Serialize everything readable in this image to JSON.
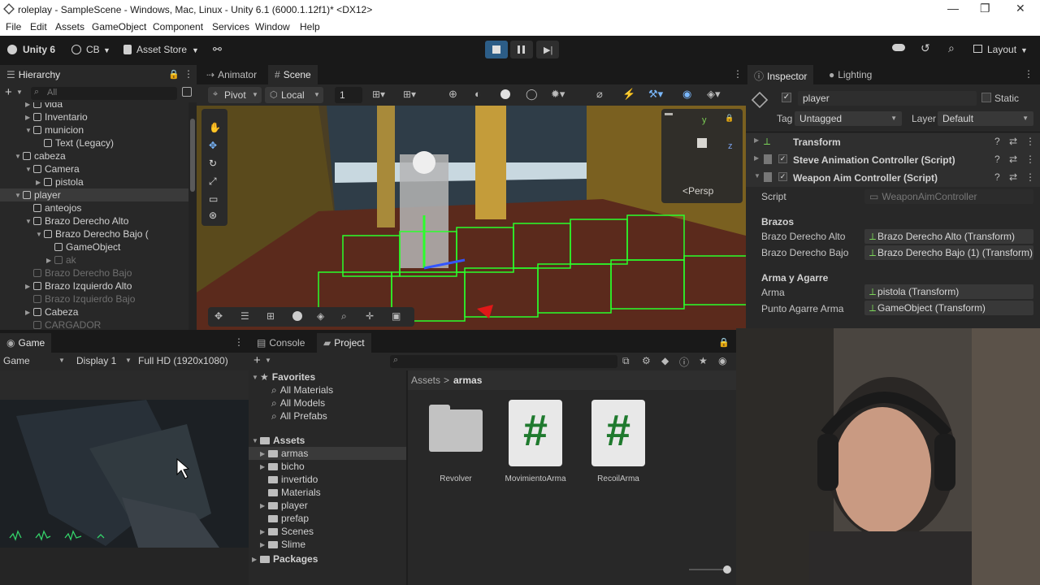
{
  "window": {
    "title": "roleplay - SampleScene - Windows, Mac, Linux - Unity 6.1 (6000.1.12f1)* <DX12>",
    "minimize": "—",
    "maximize": "❐",
    "close": "✕"
  },
  "menu": [
    "File",
    "Edit",
    "Assets",
    "GameObject",
    "Component",
    "Services",
    "Window",
    "Help"
  ],
  "toolbar": {
    "unity_label": "Unity 6",
    "account_label": "CB",
    "asset_store_label": "Asset Store",
    "layout_label": "Layout"
  },
  "hierarchy": {
    "tab_label": "Hierarchy",
    "search_placeholder": "All",
    "items": [
      {
        "label": "vida",
        "indent": 3,
        "arrow": "▶",
        "dim": false
      },
      {
        "label": "Inventario",
        "indent": 3,
        "arrow": "▶",
        "dim": false
      },
      {
        "label": "municion",
        "indent": 3,
        "arrow": "▼",
        "dim": false
      },
      {
        "label": "Text (Legacy)",
        "indent": 4,
        "arrow": "",
        "dim": false
      },
      {
        "label": "cabeza",
        "indent": 2,
        "arrow": "▼",
        "dim": false
      },
      {
        "label": "Camera",
        "indent": 3,
        "arrow": "▼",
        "dim": false
      },
      {
        "label": "pistola",
        "indent": 4,
        "arrow": "▶",
        "dim": false
      },
      {
        "label": "player",
        "indent": 2,
        "arrow": "▼",
        "dim": false,
        "selected": true
      },
      {
        "label": "anteojos",
        "indent": 3,
        "arrow": "",
        "dim": false
      },
      {
        "label": "Brazo Derecho Alto",
        "indent": 3,
        "arrow": "▼",
        "dim": false
      },
      {
        "label": "Brazo Derecho Bajo (",
        "indent": 4,
        "arrow": "▼",
        "dim": false
      },
      {
        "label": "GameObject",
        "indent": 5,
        "arrow": "",
        "dim": false
      },
      {
        "label": "ak",
        "indent": 5,
        "arrow": "▶",
        "dim": true
      },
      {
        "label": "Brazo Derecho Bajo",
        "indent": 3,
        "arrow": "",
        "dim": true
      },
      {
        "label": "Brazo Izquierdo Alto",
        "indent": 3,
        "arrow": "▶",
        "dim": false
      },
      {
        "label": "Brazo Izquierdo Bajo",
        "indent": 3,
        "arrow": "",
        "dim": true
      },
      {
        "label": "Cabeza",
        "indent": 3,
        "arrow": "▶",
        "dim": false
      },
      {
        "label": "CARGADOR",
        "indent": 3,
        "arrow": "",
        "dim": true
      }
    ]
  },
  "scene": {
    "tabs": [
      "Animator",
      "Scene"
    ],
    "pivot_label": "Pivot",
    "local_label": "Local",
    "grid_value": "1",
    "persp_label": "<Persp",
    "gizmo_y": "y",
    "gizmo_z": "z"
  },
  "game": {
    "tab_label": "Game",
    "view_label": "Game",
    "display_label": "Display 1",
    "resolution_label": "Full HD (1920x1080)"
  },
  "project": {
    "tabs": [
      "Console",
      "Project"
    ],
    "favorites_label": "Favorites",
    "favorites": [
      "All Materials",
      "All Models",
      "All Prefabs"
    ],
    "assets_label": "Assets",
    "asset_folders": [
      "armas",
      "bicho",
      "invertido",
      "Materials",
      "player",
      "prefap",
      "Scenes",
      "Slime"
    ],
    "packages_label": "Packages",
    "breadcrumb": [
      "Assets",
      "armas"
    ],
    "breadcrumb_sep": ">",
    "items": [
      {
        "label": "Revolver",
        "kind": "folder"
      },
      {
        "label": "MovimientoArma",
        "kind": "script"
      },
      {
        "label": "RecoilArma",
        "kind": "script"
      }
    ],
    "script_glyph": "#"
  },
  "inspector": {
    "tabs": [
      "Inspector",
      "Lighting"
    ],
    "object_name": "player",
    "static_label": "Static",
    "tag_label": "Tag",
    "tag_value": "Untagged",
    "layer_label": "Layer",
    "layer_value": "Default",
    "components": [
      "Transform",
      "Steve Animation Controller (Script)",
      "Weapon Aim Controller (Script)"
    ],
    "script_label": "Script",
    "script_value": "WeaponAimController",
    "brazos_header": "Brazos",
    "brazo_alto_label": "Brazo Derecho Alto",
    "brazo_alto_value": "Brazo Derecho Alto (Transform)",
    "brazo_bajo_label": "Brazo Derecho Bajo",
    "brazo_bajo_value": "Brazo Derecho Bajo (1) (Transform)",
    "arma_header": "Arma y Agarre",
    "arma_label": "Arma",
    "arma_value": "pistola (Transform)",
    "punto_label": "Punto Agarre Arma",
    "punto_value": "GameObject (Transform)"
  },
  "colors": {
    "accent": "#2c5d87",
    "selected_row": "#3a3a3a",
    "script_green": "#1f7a2e",
    "scene_grid_green": "#2bff2b"
  }
}
